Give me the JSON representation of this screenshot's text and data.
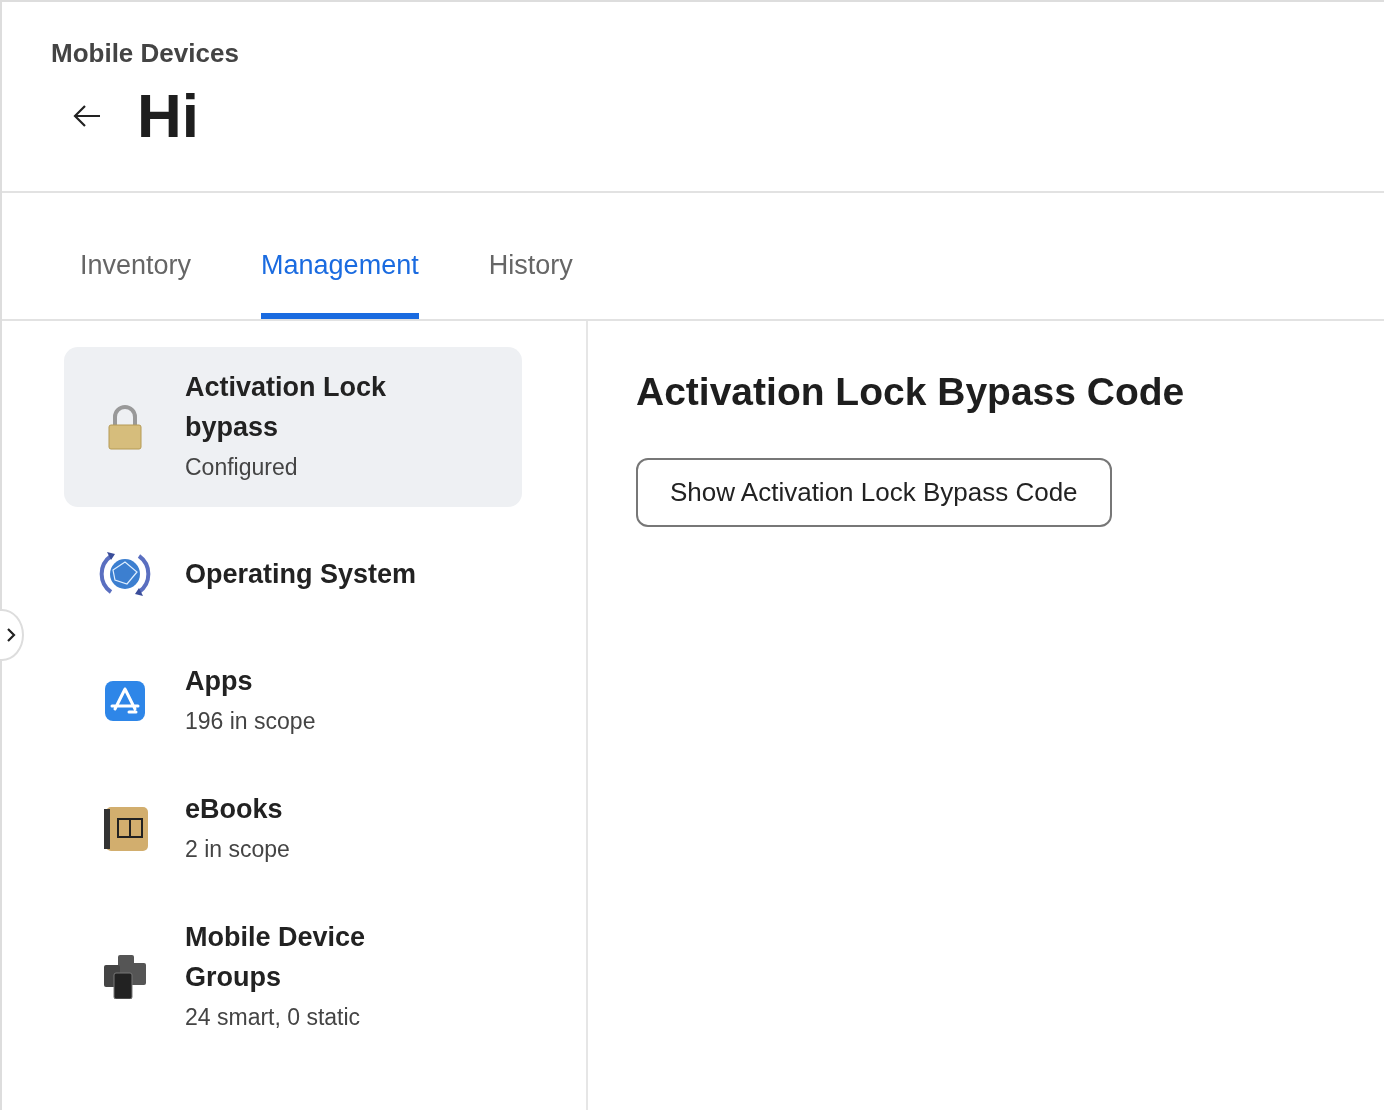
{
  "header": {
    "breadcrumb": "Mobile Devices",
    "title": "Hi"
  },
  "tabs": [
    {
      "label": "Inventory",
      "selected": false
    },
    {
      "label": "Management",
      "selected": true
    },
    {
      "label": "History",
      "selected": false
    }
  ],
  "sidebar": {
    "items": [
      {
        "title": "Activation Lock bypass",
        "subtitle": "Configured",
        "selected": true
      },
      {
        "title": "Operating System",
        "selected": false
      },
      {
        "title": "Apps",
        "subtitle": "196 in scope",
        "selected": false
      },
      {
        "title": "eBooks",
        "subtitle": "2 in scope",
        "selected": false
      },
      {
        "title": "Mobile Device Groups",
        "subtitle": "24 smart, 0 static",
        "selected": false
      }
    ]
  },
  "detail": {
    "heading": "Activation Lock Bypass Code",
    "button": "Show Activation Lock Bypass Code"
  }
}
